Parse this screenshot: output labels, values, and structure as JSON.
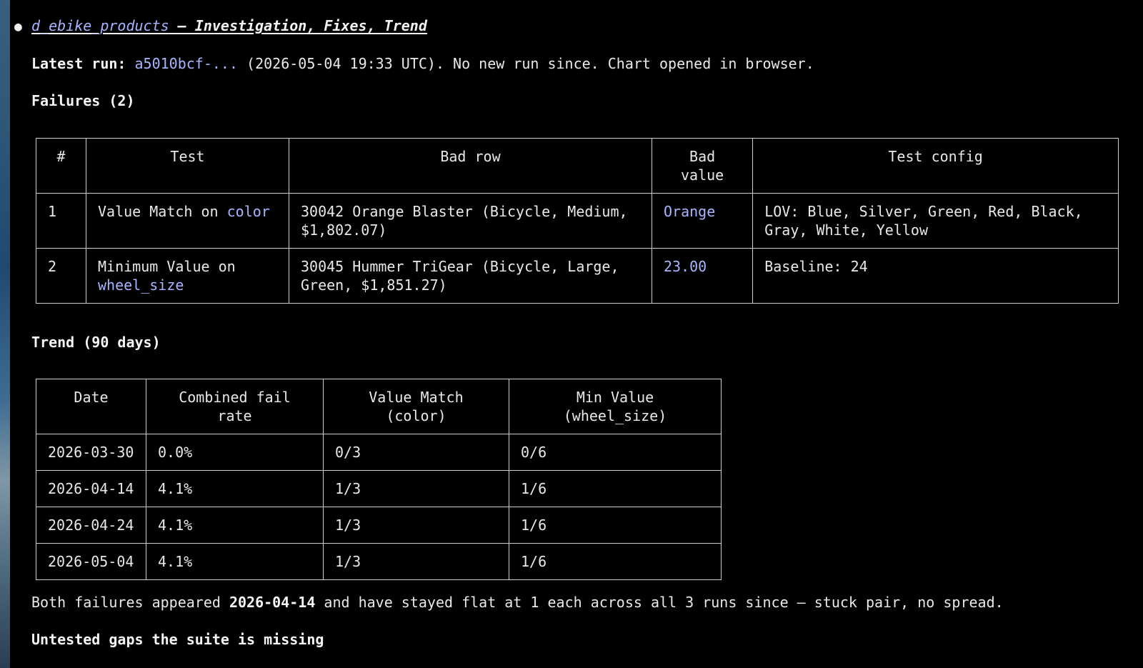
{
  "header": {
    "repo": "d_ebike_products",
    "title_rest": " – Investigation, Fixes, Trend"
  },
  "latest_run": {
    "label": "Latest run:",
    "run_id": "a5010bcf-...",
    "details": " (2026-05-04 19:33 UTC). No new run since. Chart opened in browser."
  },
  "failures": {
    "heading": "Failures (2)",
    "columns": [
      "#",
      "Test",
      "Bad row",
      "Bad value",
      "Test config"
    ],
    "rows": [
      {
        "num": "1",
        "test_prefix": "Value Match on ",
        "test_field": "color",
        "bad_row": "30042 Orange Blaster (Bicycle, Medium, $1,802.07)",
        "bad_value": "Orange",
        "config": "LOV: Blue, Silver, Green, Red, Black, Gray, White, Yellow"
      },
      {
        "num": "2",
        "test_prefix": "Minimum Value on ",
        "test_field": "wheel_size",
        "bad_row": "30045 Hummer TriGear (Bicycle, Large, Green, $1,851.27)",
        "bad_value": "23.00",
        "config": "Baseline: 24"
      }
    ]
  },
  "trend": {
    "heading": "Trend (90 days)",
    "columns": [
      "Date",
      "Combined fail rate",
      "Value Match (color)",
      "Min Value (wheel_size)"
    ],
    "rows": [
      [
        "2026-03-30",
        "0.0%",
        "0/3",
        "0/6"
      ],
      [
        "2026-04-14",
        "4.1%",
        "1/3",
        "1/6"
      ],
      [
        "2026-04-24",
        "4.1%",
        "1/3",
        "1/6"
      ],
      [
        "2026-05-04",
        "4.1%",
        "1/3",
        "1/6"
      ]
    ]
  },
  "summary": {
    "before": "Both failures appeared ",
    "date": "2026-04-14",
    "after": " and have stayed flat at 1 each across all 3 runs since – stuck pair, no spread."
  },
  "gaps_heading": "Untested gaps the suite is missing"
}
